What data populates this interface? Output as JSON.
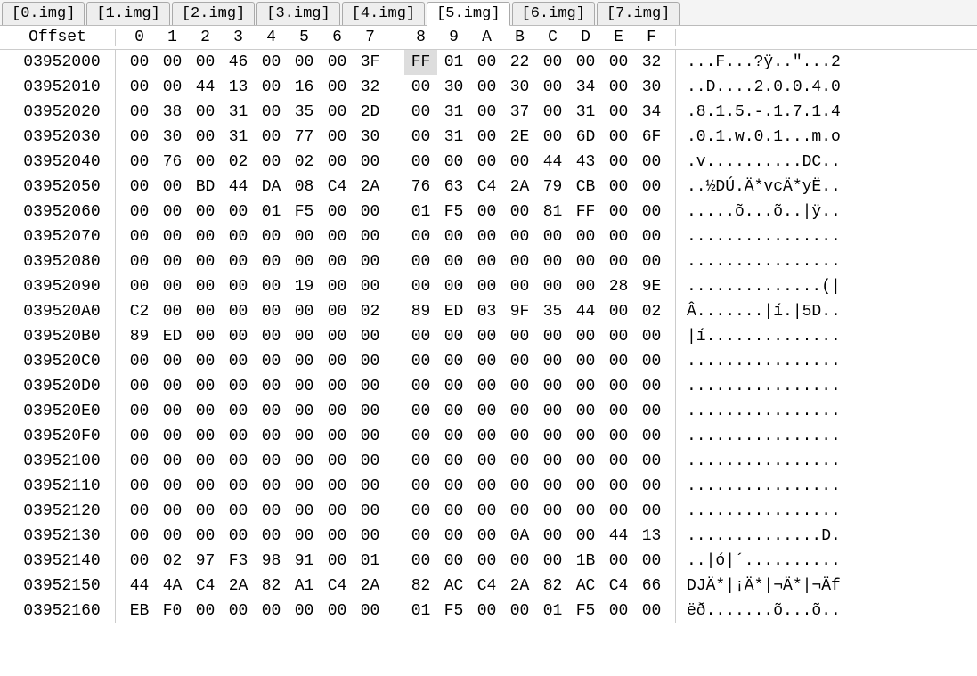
{
  "tabs": [
    {
      "label": "[0.img]",
      "active": false
    },
    {
      "label": "[1.img]",
      "active": false
    },
    {
      "label": "[2.img]",
      "active": false
    },
    {
      "label": "[3.img]",
      "active": false
    },
    {
      "label": "[4.img]",
      "active": false
    },
    {
      "label": "[5.img]",
      "active": true
    },
    {
      "label": "[6.img]",
      "active": false
    },
    {
      "label": "[7.img]",
      "active": false
    }
  ],
  "header": {
    "offset_label": "Offset",
    "columns": [
      "0",
      "1",
      "2",
      "3",
      "4",
      "5",
      "6",
      "7",
      "8",
      "9",
      "A",
      "B",
      "C",
      "D",
      "E",
      "F"
    ]
  },
  "rows": [
    {
      "offset": "03952000",
      "hex": [
        "00",
        "00",
        "00",
        "46",
        "00",
        "00",
        "00",
        "3F",
        "FF",
        "01",
        "00",
        "22",
        "00",
        "00",
        "00",
        "32"
      ],
      "ascii": "...F...?ÿ..\"...2",
      "highlight": 8
    },
    {
      "offset": "03952010",
      "hex": [
        "00",
        "00",
        "44",
        "13",
        "00",
        "16",
        "00",
        "32",
        "00",
        "30",
        "00",
        "30",
        "00",
        "34",
        "00",
        "30"
      ],
      "ascii": "..D....2.0.0.4.0"
    },
    {
      "offset": "03952020",
      "hex": [
        "00",
        "38",
        "00",
        "31",
        "00",
        "35",
        "00",
        "2D",
        "00",
        "31",
        "00",
        "37",
        "00",
        "31",
        "00",
        "34"
      ],
      "ascii": ".8.1.5.-.1.7.1.4"
    },
    {
      "offset": "03952030",
      "hex": [
        "00",
        "30",
        "00",
        "31",
        "00",
        "77",
        "00",
        "30",
        "00",
        "31",
        "00",
        "2E",
        "00",
        "6D",
        "00",
        "6F"
      ],
      "ascii": ".0.1.w.0.1...m.o"
    },
    {
      "offset": "03952040",
      "hex": [
        "00",
        "76",
        "00",
        "02",
        "00",
        "02",
        "00",
        "00",
        "00",
        "00",
        "00",
        "00",
        "44",
        "43",
        "00",
        "00"
      ],
      "ascii": ".v..........DC.."
    },
    {
      "offset": "03952050",
      "hex": [
        "00",
        "00",
        "BD",
        "44",
        "DA",
        "08",
        "C4",
        "2A",
        "76",
        "63",
        "C4",
        "2A",
        "79",
        "CB",
        "00",
        "00"
      ],
      "ascii": "..½DÚ.Ä*vcÄ*yË.."
    },
    {
      "offset": "03952060",
      "hex": [
        "00",
        "00",
        "00",
        "00",
        "01",
        "F5",
        "00",
        "00",
        "01",
        "F5",
        "00",
        "00",
        "81",
        "FF",
        "00",
        "00"
      ],
      "ascii": ".....õ...õ..|ÿ.."
    },
    {
      "offset": "03952070",
      "hex": [
        "00",
        "00",
        "00",
        "00",
        "00",
        "00",
        "00",
        "00",
        "00",
        "00",
        "00",
        "00",
        "00",
        "00",
        "00",
        "00"
      ],
      "ascii": "................"
    },
    {
      "offset": "03952080",
      "hex": [
        "00",
        "00",
        "00",
        "00",
        "00",
        "00",
        "00",
        "00",
        "00",
        "00",
        "00",
        "00",
        "00",
        "00",
        "00",
        "00"
      ],
      "ascii": "................"
    },
    {
      "offset": "03952090",
      "hex": [
        "00",
        "00",
        "00",
        "00",
        "00",
        "19",
        "00",
        "00",
        "00",
        "00",
        "00",
        "00",
        "00",
        "00",
        "28",
        "9E"
      ],
      "ascii": "..............(|"
    },
    {
      "offset": "039520A0",
      "hex": [
        "C2",
        "00",
        "00",
        "00",
        "00",
        "00",
        "00",
        "02",
        "89",
        "ED",
        "03",
        "9F",
        "35",
        "44",
        "00",
        "02"
      ],
      "ascii": "Â.......|í.|5D.."
    },
    {
      "offset": "039520B0",
      "hex": [
        "89",
        "ED",
        "00",
        "00",
        "00",
        "00",
        "00",
        "00",
        "00",
        "00",
        "00",
        "00",
        "00",
        "00",
        "00",
        "00"
      ],
      "ascii": "|í.............."
    },
    {
      "offset": "039520C0",
      "hex": [
        "00",
        "00",
        "00",
        "00",
        "00",
        "00",
        "00",
        "00",
        "00",
        "00",
        "00",
        "00",
        "00",
        "00",
        "00",
        "00"
      ],
      "ascii": "................"
    },
    {
      "offset": "039520D0",
      "hex": [
        "00",
        "00",
        "00",
        "00",
        "00",
        "00",
        "00",
        "00",
        "00",
        "00",
        "00",
        "00",
        "00",
        "00",
        "00",
        "00"
      ],
      "ascii": "................"
    },
    {
      "offset": "039520E0",
      "hex": [
        "00",
        "00",
        "00",
        "00",
        "00",
        "00",
        "00",
        "00",
        "00",
        "00",
        "00",
        "00",
        "00",
        "00",
        "00",
        "00"
      ],
      "ascii": "................"
    },
    {
      "offset": "039520F0",
      "hex": [
        "00",
        "00",
        "00",
        "00",
        "00",
        "00",
        "00",
        "00",
        "00",
        "00",
        "00",
        "00",
        "00",
        "00",
        "00",
        "00"
      ],
      "ascii": "................"
    },
    {
      "offset": "03952100",
      "hex": [
        "00",
        "00",
        "00",
        "00",
        "00",
        "00",
        "00",
        "00",
        "00",
        "00",
        "00",
        "00",
        "00",
        "00",
        "00",
        "00"
      ],
      "ascii": "................"
    },
    {
      "offset": "03952110",
      "hex": [
        "00",
        "00",
        "00",
        "00",
        "00",
        "00",
        "00",
        "00",
        "00",
        "00",
        "00",
        "00",
        "00",
        "00",
        "00",
        "00"
      ],
      "ascii": "................"
    },
    {
      "offset": "03952120",
      "hex": [
        "00",
        "00",
        "00",
        "00",
        "00",
        "00",
        "00",
        "00",
        "00",
        "00",
        "00",
        "00",
        "00",
        "00",
        "00",
        "00"
      ],
      "ascii": "................"
    },
    {
      "offset": "03952130",
      "hex": [
        "00",
        "00",
        "00",
        "00",
        "00",
        "00",
        "00",
        "00",
        "00",
        "00",
        "00",
        "0A",
        "00",
        "00",
        "44",
        "13"
      ],
      "ascii": "..............D."
    },
    {
      "offset": "03952140",
      "hex": [
        "00",
        "02",
        "97",
        "F3",
        "98",
        "91",
        "00",
        "01",
        "00",
        "00",
        "00",
        "00",
        "00",
        "1B",
        "00",
        "00"
      ],
      "ascii": "..|ó|´.........."
    },
    {
      "offset": "03952150",
      "hex": [
        "44",
        "4A",
        "C4",
        "2A",
        "82",
        "A1",
        "C4",
        "2A",
        "82",
        "AC",
        "C4",
        "2A",
        "82",
        "AC",
        "C4",
        "66"
      ],
      "ascii": "DJÄ*|¡Ä*|¬Ä*|¬Äf"
    },
    {
      "offset": "03952160",
      "hex": [
        "EB",
        "F0",
        "00",
        "00",
        "00",
        "00",
        "00",
        "00",
        "01",
        "F5",
        "00",
        "00",
        "01",
        "F5",
        "00",
        "00"
      ],
      "ascii": "ëð.......õ...õ.."
    }
  ]
}
